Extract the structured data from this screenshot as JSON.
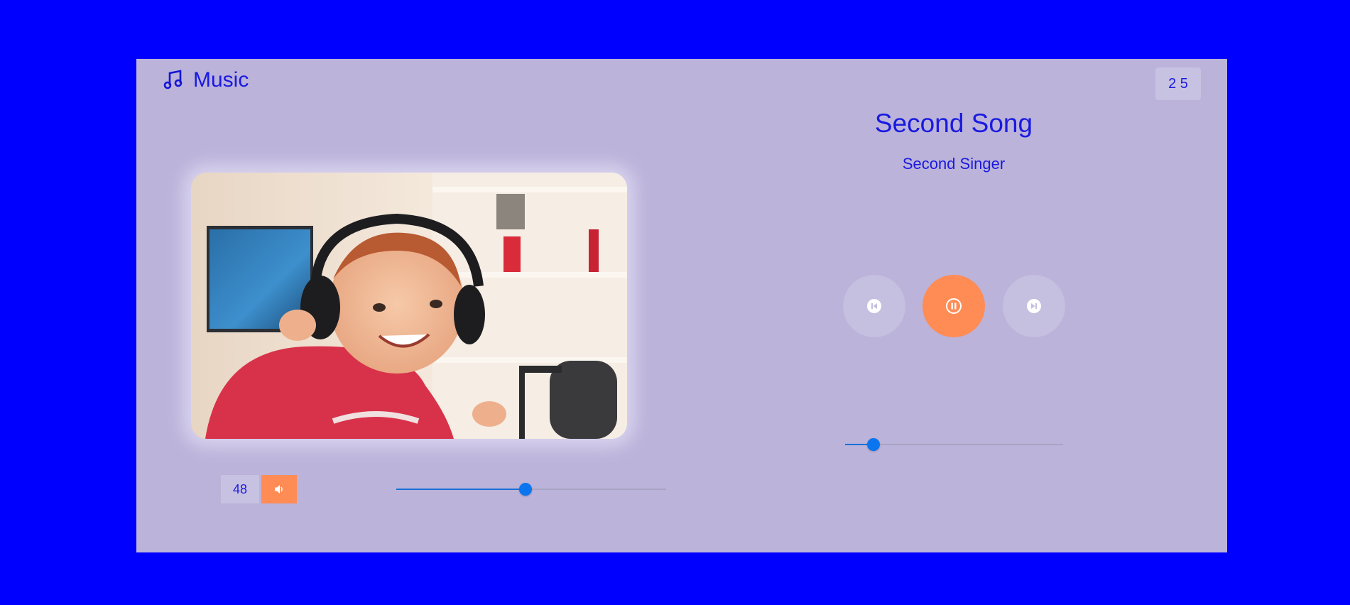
{
  "app": {
    "title": "Music",
    "counter": "2 5"
  },
  "track": {
    "title": "Second Song",
    "artist": "Second Singer",
    "progress_fraction": 0.13
  },
  "volume": {
    "value": "48",
    "level_fraction": 0.48
  },
  "controls": {
    "prev_icon": "previous-track-icon",
    "play_icon": "pause-icon",
    "next_icon": "next-track-icon",
    "volume_icon": "speaker-icon"
  },
  "colors": {
    "background": "#0000ff",
    "panel": "#bbb3da",
    "accent": "#ff8c55",
    "text": "#1a1ae0",
    "slider": "#0a75ee"
  }
}
